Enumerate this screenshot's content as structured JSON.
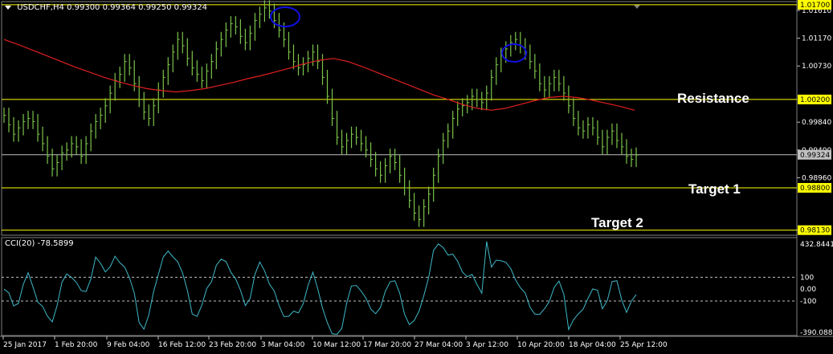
{
  "header": {
    "symbol": "USDCHF,H4",
    "ohlc": "0.99300 0.99364 0.99250 0.99324"
  },
  "cci_panel": {
    "label": "CCI(20) -78.5899",
    "axis_ticks": [
      "432.8441",
      "100",
      "0.00",
      "-100",
      "-390.0889"
    ]
  },
  "annotations": {
    "resistance": "Resistance",
    "target1": "Target 1",
    "target2": "Target 2"
  },
  "chart_data": {
    "type": "line",
    "title": "USDCHF,H4",
    "ylim": [
      0.9805,
      1.0175
    ],
    "price_axis_ticks": [
      1.0161,
      1.0117,
      1.0073,
      0.9984,
      0.994,
      0.9896,
      0.9813
    ],
    "x_tick_labels": [
      "25 Jan 2017",
      "1 Feb 20:00",
      "9 Feb 04:00",
      "16 Feb 12:00",
      "23 Feb 20:00",
      "3 Mar 04:00",
      "10 Mar 12:00",
      "17 Mar 20:00",
      "27 Mar 04:00",
      "3 Apr 12:00",
      "10 Apr 20:00",
      "18 Apr 04:00",
      "25 Apr 12:00"
    ],
    "horizontal_levels": [
      {
        "value": 1.017,
        "label": "1.01700",
        "color": "#ffff00"
      },
      {
        "value": 1.002,
        "label": "1.00200",
        "color": "#ffff00"
      },
      {
        "value": 0.988,
        "label": "0.98800",
        "color": "#ffff00"
      },
      {
        "value": 0.9813,
        "label": "0.98130",
        "color": "#ffff00"
      },
      {
        "value": 0.99324,
        "label": "0.99324",
        "color": "#c0c0c0"
      }
    ],
    "series": [
      {
        "color": "#7cc44a",
        "values": [
          0.9995,
          0.998,
          0.9965,
          0.9975,
          0.9985,
          0.999,
          0.9985,
          0.9965,
          0.995,
          0.993,
          0.991,
          0.992,
          0.9935,
          0.994,
          0.995,
          0.9945,
          0.993,
          0.995,
          0.997,
          0.9985,
          0.9995,
          1.001,
          1.003,
          1.005,
          1.006,
          1.008,
          1.007,
          1.0045,
          1.002,
          1.0,
          0.999,
          1.001,
          1.0035,
          1.0055,
          1.0075,
          1.0095,
          1.0115,
          1.0105,
          1.0085,
          1.007,
          1.006,
          1.005,
          1.0065,
          1.008,
          1.01,
          1.0115,
          1.013,
          1.014,
          1.0135,
          1.012,
          1.011,
          1.0125,
          1.0145,
          1.0155,
          1.0165,
          1.016,
          1.0145,
          1.013,
          1.0115,
          1.0095,
          1.008,
          1.007,
          1.0075,
          1.0085,
          1.0095,
          1.008,
          1.0055,
          1.0025,
          0.999,
          0.996,
          0.9945,
          0.9955,
          0.9965,
          0.996,
          0.995,
          0.994,
          0.9925,
          0.991,
          0.99,
          0.9915,
          0.993,
          0.992,
          0.99,
          0.988,
          0.986,
          0.984,
          0.983,
          0.985,
          0.987,
          0.99,
          0.993,
          0.9955,
          0.997,
          0.999,
          1.0005,
          1.001,
          1.0015,
          1.0025,
          1.002,
          1.0015,
          1.003,
          1.0055,
          1.0075,
          1.009,
          1.01,
          1.011,
          1.0115,
          1.0105,
          1.0095,
          1.008,
          1.0065,
          1.0045,
          1.0035,
          1.0045,
          1.0055,
          1.0045,
          1.003,
          1.001,
          0.999,
          0.9975,
          0.997,
          0.998,
          0.9975,
          0.996,
          0.9945,
          0.996,
          0.997,
          0.9955,
          0.9945,
          0.993,
          0.9925,
          0.9932
        ]
      },
      {
        "color": "#e02020",
        "values": [
          1.0115,
          1.0107,
          1.0098,
          1.0089,
          1.008,
          1.0071,
          1.0063,
          1.0055,
          1.0048,
          1.0042,
          1.0037,
          1.0034,
          1.0032,
          1.0034,
          1.0037,
          1.0042,
          1.0047,
          1.0053,
          1.0058,
          1.0064,
          1.007,
          1.0077,
          1.0082,
          1.0085,
          1.008,
          1.0072,
          1.0063,
          1.0054,
          1.0045,
          1.0036,
          1.0027,
          1.002,
          1.0012,
          1.0006,
          1.0003,
          1.0006,
          1.0012,
          1.0018,
          1.0023,
          1.0025,
          1.0023,
          1.0019,
          1.0014,
          1.0009,
          1.0003
        ]
      }
    ]
  },
  "cci_data": {
    "ylim": [
      -390.0889,
      432.8441
    ],
    "levels": [
      100,
      0,
      -100
    ]
  }
}
